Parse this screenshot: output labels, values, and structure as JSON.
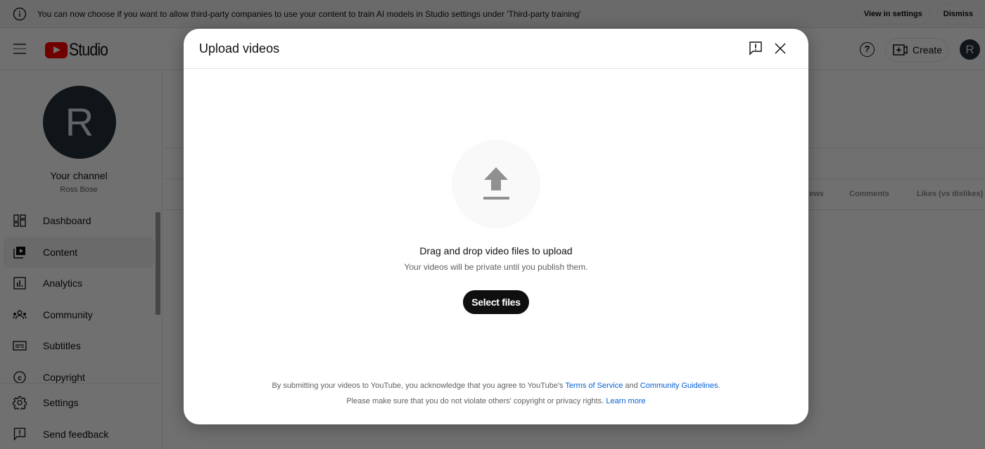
{
  "banner": {
    "message": "You can now choose if you want to allow third-party companies to use your content to train AI models in Studio settings under 'Third-party training'",
    "view_settings": "View in settings",
    "dismiss": "Dismiss"
  },
  "topbar": {
    "brand": "Studio",
    "help_glyph": "?",
    "create_label": "Create",
    "avatar_initial": "R"
  },
  "sidebar": {
    "avatar_initial": "R",
    "channel_title": "Your channel",
    "channel_name": "Ross Bose",
    "items": [
      {
        "label": "Dashboard",
        "icon": "dashboard-icon"
      },
      {
        "label": "Content",
        "icon": "content-icon",
        "active": true
      },
      {
        "label": "Analytics",
        "icon": "analytics-icon"
      },
      {
        "label": "Community",
        "icon": "community-icon"
      },
      {
        "label": "Subtitles",
        "icon": "subtitles-icon"
      },
      {
        "label": "Copyright",
        "icon": "copyright-icon"
      }
    ],
    "bottom_items": [
      {
        "label": "Settings",
        "icon": "gear-icon"
      },
      {
        "label": "Send feedback",
        "icon": "feedback-icon"
      }
    ]
  },
  "table": {
    "columns": [
      "Views",
      "Comments",
      "Likes (vs dislikes)"
    ],
    "views_partial": "ews"
  },
  "dialog": {
    "title": "Upload videos",
    "drag_text": "Drag and drop video files to upload",
    "private_text": "Your videos will be private until you publish them.",
    "select_button": "Select files",
    "legal_line1_prefix": "By submitting your videos to YouTube, you acknowledge that you agree to YouTube's ",
    "terms_link": "Terms of Service",
    "and_text": " and ",
    "guidelines_link": "Community Guidelines",
    "period": ".",
    "legal_line2_prefix": "Please make sure that you do not violate others' copyright or privacy rights. ",
    "learn_more_link": "Learn more"
  },
  "colors": {
    "brand_red": "#ff0000",
    "link_blue": "#065fd4",
    "avatar_bg": "#233038"
  }
}
